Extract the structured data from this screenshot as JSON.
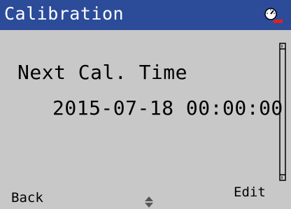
{
  "header": {
    "title": "Calibration",
    "status_icon": "gauge-alarm-icon",
    "bar_color": "#2c4c9a",
    "alarm_color": "#e02020"
  },
  "content": {
    "label": "Next Cal. Time",
    "value": "2015-07-18 00:00:00"
  },
  "softkeys": {
    "left": "Back",
    "right": "Edit",
    "nav_icon": "up-down-arrows-icon"
  },
  "scrollbar": {
    "position": 0,
    "visible_fraction": 1.0
  }
}
